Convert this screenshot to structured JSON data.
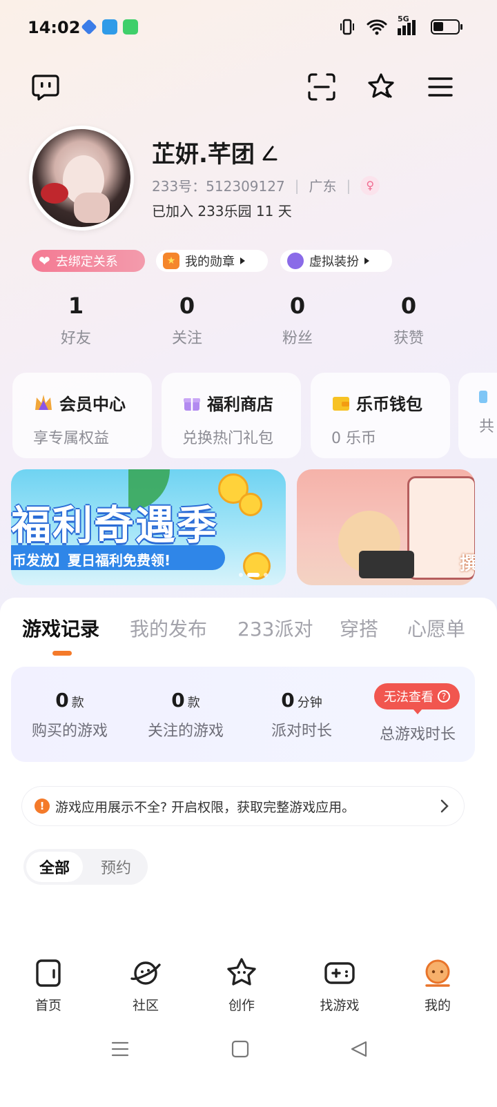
{
  "status_bar": {
    "time": "14:02",
    "network": "5G",
    "apps": [
      "blue-app-icon",
      "wifi-app-icon",
      "green-app-icon"
    ]
  },
  "header": {
    "icons": [
      "chat-bubble-icon",
      "scan-icon",
      "star-badge-icon",
      "menu-icon"
    ]
  },
  "profile": {
    "name": "芷妍.芊团",
    "id_label": "233号：512309127",
    "region": "广东",
    "gender_icon": "female-icon",
    "joined": "已加入 233乐园 11 天"
  },
  "pills": [
    {
      "label": "去绑定关系",
      "icon": "heart-icon"
    },
    {
      "label": "我的勋章",
      "icon": "medal-icon"
    },
    {
      "label": "虚拟装扮",
      "icon": "cat-mask-icon"
    }
  ],
  "stats": [
    {
      "value": "1",
      "label": "好友"
    },
    {
      "value": "0",
      "label": "关注"
    },
    {
      "value": "0",
      "label": "粉丝"
    },
    {
      "value": "0",
      "label": "获赞"
    }
  ],
  "cards": [
    {
      "title": "会员中心",
      "sub": "享专属权益",
      "icon": "crown-icon"
    },
    {
      "title": "福利商店",
      "sub": "兑换热门礼包",
      "icon": "gift-icon"
    },
    {
      "title": "乐币钱包",
      "sub": "0 乐币",
      "icon": "wallet-icon"
    },
    {
      "title": "",
      "sub": "共",
      "icon": "diamond-icon"
    }
  ],
  "banners": {
    "main_title": "福利奇遇季",
    "main_tag": "币发放】夏日福利免费领!",
    "side_text": "撰"
  },
  "tabs": [
    "游戏记录",
    "我的发布",
    "233派对",
    "穿搭",
    "心愿单"
  ],
  "game_stats": [
    {
      "value": "0",
      "unit": "款",
      "label": "购买的游戏"
    },
    {
      "value": "0",
      "unit": "款",
      "label": "关注的游戏"
    },
    {
      "value": "0",
      "unit": "分钟",
      "label": "派对时长"
    },
    {
      "value": "",
      "unit": "",
      "label": "总游戏时长"
    }
  ],
  "no_check_label": "无法查看",
  "notice": "游戏应用展示不全? 开启权限，获取完整游戏应用。",
  "filter": {
    "all": "全部",
    "reserve": "预约"
  },
  "bottom_nav": [
    {
      "label": "首页",
      "icon": "home-icon"
    },
    {
      "label": "社区",
      "icon": "planet-icon"
    },
    {
      "label": "创作",
      "icon": "star-create-icon"
    },
    {
      "label": "找游戏",
      "icon": "gamepad-icon"
    },
    {
      "label": "我的",
      "icon": "mine-face-icon"
    }
  ],
  "colors": {
    "accent": "#f47a2a",
    "pink_pill": "#f47a93",
    "alert_red": "#f1564f"
  }
}
